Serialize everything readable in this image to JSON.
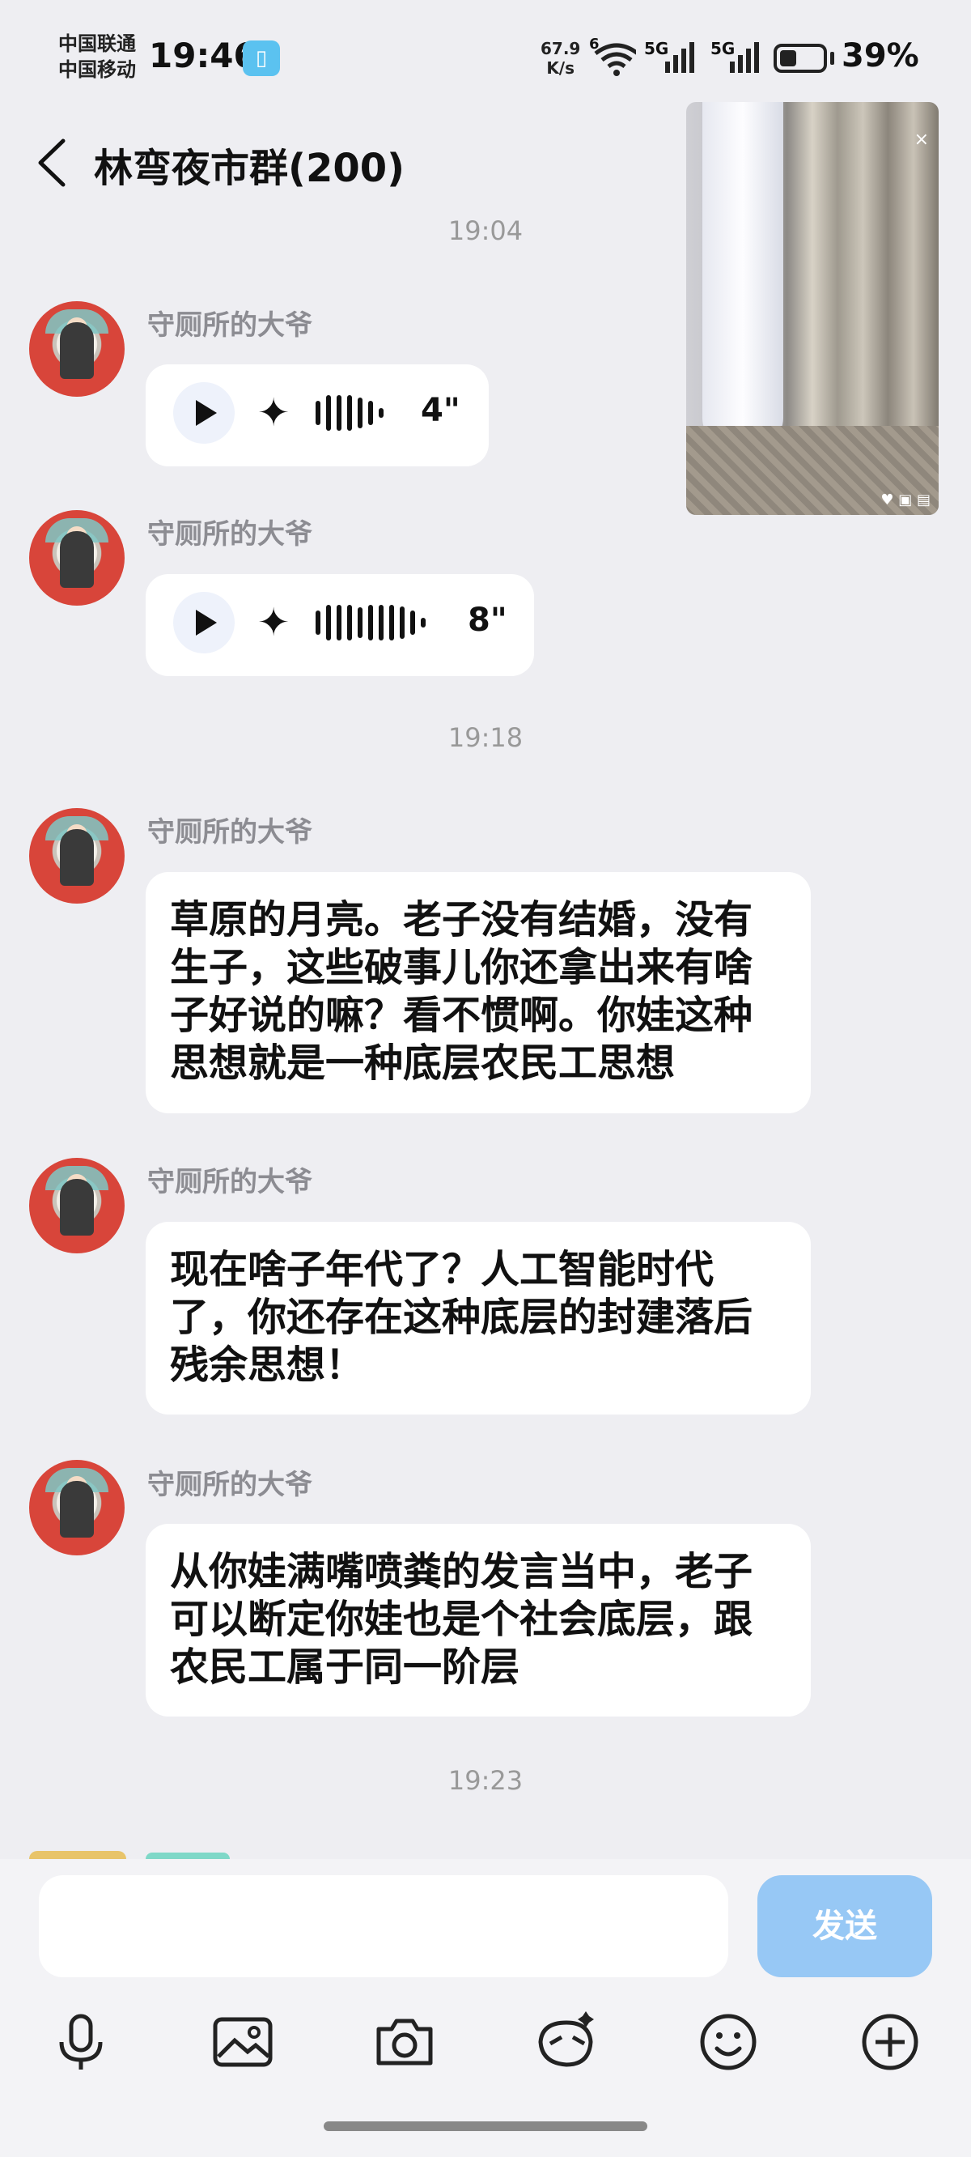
{
  "status_bar": {
    "carrier_1": "中国联通",
    "carrier_2": "中国移动",
    "time": "19:46",
    "net_speed_value": "67.9",
    "net_speed_unit": "K/s",
    "wifi_badge": "6",
    "signal_1": "5G",
    "signal_2": "5G",
    "battery": "39%",
    "battery_level": 0.39
  },
  "header": {
    "title": "林弯夜市群(200)"
  },
  "pip": {
    "close": "×"
  },
  "messages": {
    "t1": "19:04",
    "m1_name": "守厕所的大爷",
    "m1_duration": "4\"",
    "m2_name": "守厕所的大爷",
    "m2_duration": "8\"",
    "t2": "19:18",
    "m3_name": "守厕所的大爷",
    "m3_text": "草原的月亮。老子没有结婚，没有生子，这些破事儿你还拿出来有啥子好说的嘛？看不惯啊。你娃这种思想就是一种底层农民工思想",
    "m4_name": "守厕所的大爷",
    "m4_text": "现在啥子年代了？人工智能时代了，你还存在这种底层的封建落后残余思想！",
    "m5_name": "守厕所的大爷",
    "m5_text": "从你娃满嘴喷粪的发言当中，老子可以断定你娃也是个社会底层，跟农民工属于同一阶层",
    "t3": "19:23"
  },
  "composer": {
    "send_label": "发送"
  },
  "icons": [
    "back-arrow-icon",
    "voice-input-icon",
    "image-icon",
    "camera-icon",
    "sticker-icon",
    "emoji-icon",
    "plus-icon",
    "play-icon",
    "sparkle-icon"
  ],
  "colors": {
    "background": "#eeeef2",
    "bubble": "#ffffff",
    "send_button": "#97c8f5",
    "name_text": "#8c8c92"
  }
}
